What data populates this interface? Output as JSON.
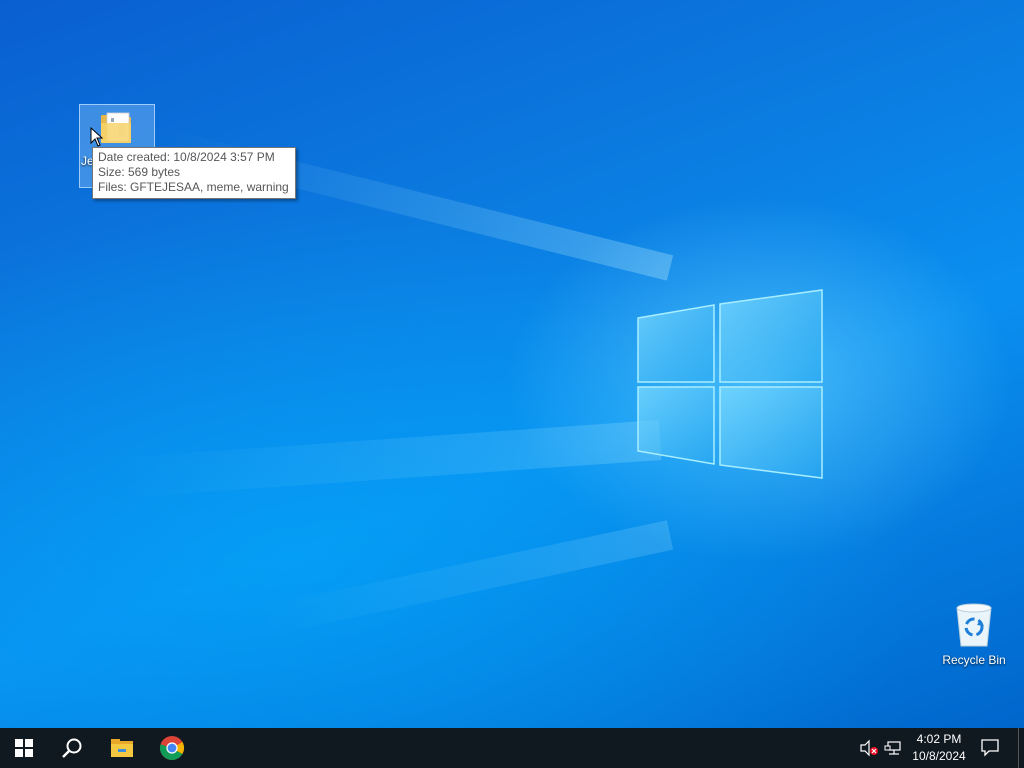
{
  "desktop": {
    "folder_icon": {
      "label": "Je"
    },
    "tooltip": {
      "date_created": "Date created: 10/8/2024 3:57 PM",
      "size": "Size: 569 bytes",
      "files": "Files: GFTEJESAA, meme, warning"
    },
    "recycle_bin": {
      "label": "Recycle Bin"
    }
  },
  "taskbar": {
    "buttons": [
      {
        "name": "start",
        "icon": "windows-logo-icon"
      },
      {
        "name": "search",
        "icon": "search-icon"
      },
      {
        "name": "file-explorer",
        "icon": "folder-icon"
      },
      {
        "name": "chrome",
        "icon": "chrome-icon"
      }
    ],
    "tray": {
      "volume_icon": "volume-muted-icon",
      "network_icon": "network-icon",
      "time": "4:02 PM",
      "date": "10/8/2024",
      "notification_icon": "notification-icon"
    }
  },
  "colors": {
    "taskbar": "#101820",
    "desktop_accent": "#0a7fe0",
    "tooltip_border": "#767676"
  }
}
